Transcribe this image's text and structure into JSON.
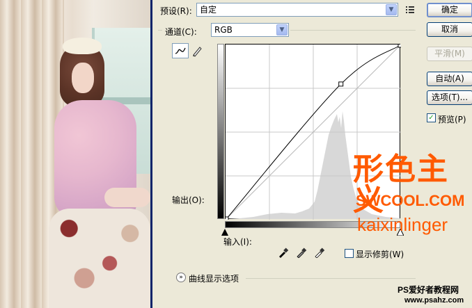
{
  "preset": {
    "label": "预设(R):",
    "value": "自定"
  },
  "channel": {
    "label": "通道(C):",
    "value": "RGB"
  },
  "buttons": {
    "ok": "确定",
    "cancel": "取消",
    "smooth": "平滑(M)",
    "auto": "自动(A)",
    "options": "选项(T)..."
  },
  "preview": {
    "label": "预览(P)",
    "checked": true
  },
  "output_label": "输出(O):",
  "input_label": "输入(I):",
  "show_clipping": {
    "label": "显示修剪(W)",
    "checked": false
  },
  "curve_options_label": "曲线显示选项",
  "watermark": {
    "brand": "形色主义",
    "site": "SWCOOL.COM",
    "author": "kaixinlinger",
    "footer1": "PS爱好者教程网",
    "footer2": "www.psahz.com"
  },
  "curve": {
    "points_input_output": [
      [
        0,
        0
      ],
      [
        168,
        198
      ],
      [
        255,
        255
      ]
    ]
  }
}
